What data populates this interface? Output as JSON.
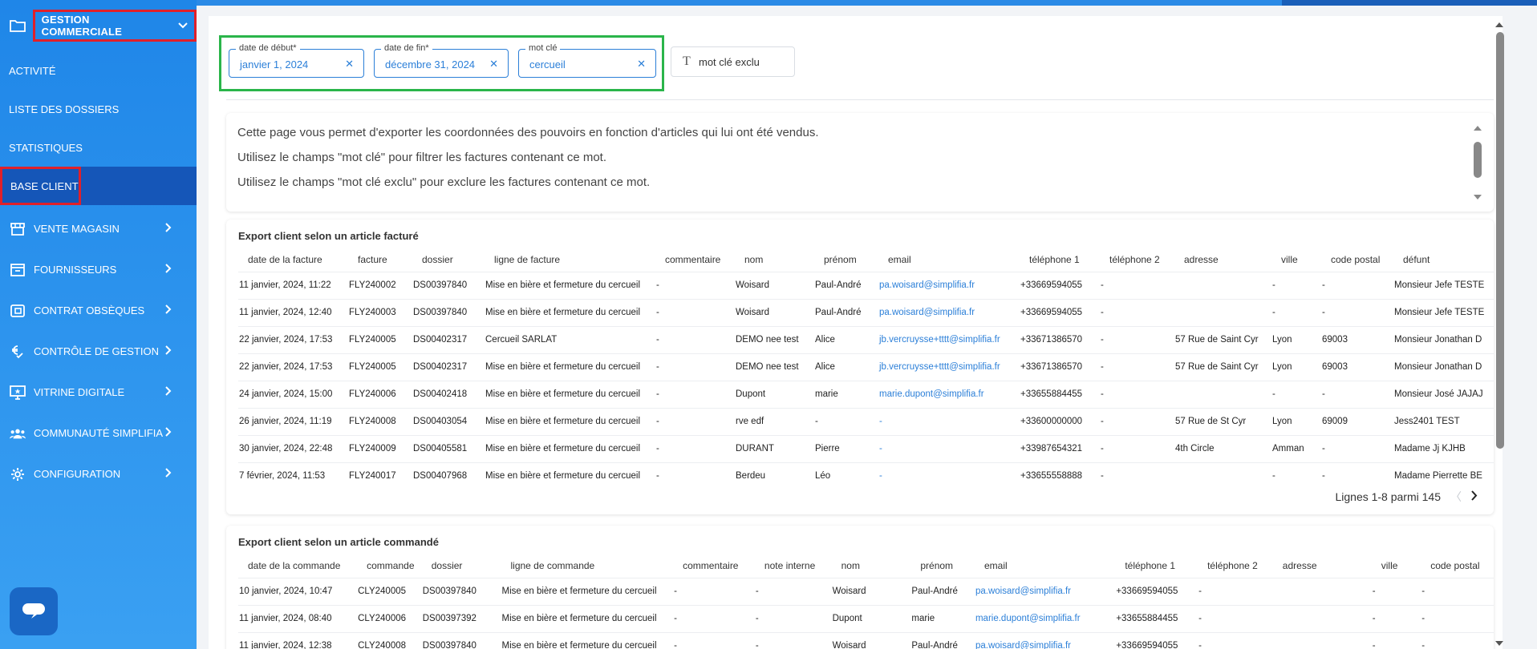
{
  "sidebar": {
    "section_title": "GESTION COMMERCIALE",
    "subitems": [
      "ACTIVITÉ",
      "LISTE DES DOSSIERS",
      "STATISTIQUES",
      "BASE CLIENT"
    ],
    "menu": [
      {
        "label": "VENTE MAGASIN",
        "icon": "store-icon"
      },
      {
        "label": "FOURNISSEURS",
        "icon": "archive-box-icon"
      },
      {
        "label": "CONTRAT OBSÈQUES",
        "icon": "contract-icon"
      },
      {
        "label": "CONTRÔLE DE GESTION",
        "icon": "euro-check-icon"
      },
      {
        "label": "VITRINE DIGITALE",
        "icon": "monitor-star-icon"
      },
      {
        "label": "COMMUNAUTÉ SIMPLIFIA",
        "icon": "community-icon"
      },
      {
        "label": "CONFIGURATION",
        "icon": "gear-icon"
      }
    ]
  },
  "filters": {
    "start": {
      "label": "date de début*",
      "value": "janvier 1, 2024"
    },
    "end": {
      "label": "date de fin*",
      "value": "décembre 31, 2024"
    },
    "keyword": {
      "label": "mot clé",
      "value": "cercueil"
    },
    "exclude": {
      "placeholder": "mot clé exclu"
    }
  },
  "info": {
    "lines": [
      "Cette page vous permet d'exporter les coordonnées des pouvoirs en fonction d'articles qui lui ont été vendus.",
      "Utilisez le champs \"mot clé\" pour filtrer les factures contenant ce mot.",
      "Utilisez le champs \"mot clé exclu\" pour exclure les factures contenant ce mot."
    ]
  },
  "invoice_table": {
    "title": "Export client selon un article facturé",
    "columns": [
      "date de la facture",
      "facture",
      "dossier",
      "ligne de facture",
      "commentaire",
      "nom",
      "prénom",
      "email",
      "téléphone 1",
      "téléphone 2",
      "adresse",
      "ville",
      "code postal",
      "défunt"
    ],
    "rows": [
      [
        "11 janvier, 2024, 11:22",
        "FLY240002",
        "DS00397840",
        "Mise en bière et fermeture du cercueil",
        "-",
        "Woisard",
        "Paul-André",
        "pa.woisard@simplifia.fr",
        "+33669594055",
        "-",
        "",
        "-",
        "-",
        "Monsieur Jefe TESTE"
      ],
      [
        "11 janvier, 2024, 12:40",
        "FLY240003",
        "DS00397840",
        "Mise en bière et fermeture du cercueil",
        "-",
        "Woisard",
        "Paul-André",
        "pa.woisard@simplifia.fr",
        "+33669594055",
        "-",
        "",
        "-",
        "-",
        "Monsieur Jefe TESTE"
      ],
      [
        "22 janvier, 2024, 17:53",
        "FLY240005",
        "DS00402317",
        "Cercueil SARLAT",
        "-",
        "DEMO nee test",
        "Alice",
        "jb.vercruysse+tttt@simplifia.fr",
        "+33671386570",
        "-",
        "57 Rue de Saint Cyr",
        "Lyon",
        "69003",
        "Monsieur Jonathan D"
      ],
      [
        "22 janvier, 2024, 17:53",
        "FLY240005",
        "DS00402317",
        "Mise en bière et fermeture du cercueil",
        "-",
        "DEMO nee test",
        "Alice",
        "jb.vercruysse+tttt@simplifia.fr",
        "+33671386570",
        "-",
        "57 Rue de Saint Cyr",
        "Lyon",
        "69003",
        "Monsieur Jonathan D"
      ],
      [
        "24 janvier, 2024, 15:00",
        "FLY240006",
        "DS00402418",
        "Mise en bière et fermeture du cercueil",
        "-",
        "Dupont",
        "marie",
        "marie.dupont@simplifia.fr",
        "+33655884455",
        "-",
        "",
        "-",
        "-",
        "Monsieur José JAJAJ"
      ],
      [
        "26 janvier, 2024, 11:19",
        "FLY240008",
        "DS00403054",
        "Mise en bière et fermeture du cercueil",
        "-",
        "rve edf",
        "-",
        "-",
        "+33600000000",
        "-",
        "57 Rue de St Cyr",
        "Lyon",
        "69009",
        "Jess2401 TEST"
      ],
      [
        "30 janvier, 2024, 22:48",
        "FLY240009",
        "DS00405581",
        "Mise en bière et fermeture du cercueil",
        "-",
        "DURANT",
        "Pierre",
        "-",
        "+33987654321",
        "-",
        "4th Circle",
        "Amman",
        "-",
        "Madame Jj KJHB"
      ],
      [
        "7 février, 2024, 11:53",
        "FLY240017",
        "DS00407968",
        "Mise en bière et fermeture du cercueil",
        "-",
        "Berdeu",
        "Léo",
        "-",
        "+33655558888",
        "-",
        "",
        "-",
        "-",
        "Madame Pierrette BE"
      ]
    ],
    "pagination": "Lignes 1-8 parmi 145"
  },
  "order_table": {
    "title": "Export client selon un article commandé",
    "columns": [
      "date de la commande",
      "commande",
      "dossier",
      "ligne de commande",
      "commentaire",
      "note interne",
      "nom",
      "prénom",
      "email",
      "téléphone 1",
      "téléphone 2",
      "adresse",
      "ville",
      "code postal"
    ],
    "rows": [
      [
        "10 janvier, 2024, 10:47",
        "CLY240005",
        "DS00397840",
        "Mise en bière et fermeture du cercueil",
        "-",
        "-",
        "Woisard",
        "Paul-André",
        "pa.woisard@simplifia.fr",
        "+33669594055",
        "-",
        "",
        "-",
        "-"
      ],
      [
        "11 janvier, 2024, 08:40",
        "CLY240006",
        "DS00397392",
        "Mise en bière et fermeture du cercueil",
        "-",
        "-",
        "Dupont",
        "marie",
        "marie.dupont@simplifia.fr",
        "+33655884455",
        "-",
        "",
        "-",
        "-"
      ],
      [
        "11 janvier, 2024, 12:38",
        "CLY240008",
        "DS00397840",
        "Mise en bière et fermeture du cercueil",
        "-",
        "-",
        "Woisard",
        "Paul-André",
        "pa.woisard@simplifia.fr",
        "+33669594055",
        "-",
        "",
        "-",
        "-"
      ]
    ]
  },
  "colors": {
    "sidebar": "#2e95ee",
    "active": "#1556b8",
    "accent": "#2b7fd8",
    "highlight_red": "#e0202a",
    "highlight_green": "#2ab54a"
  }
}
